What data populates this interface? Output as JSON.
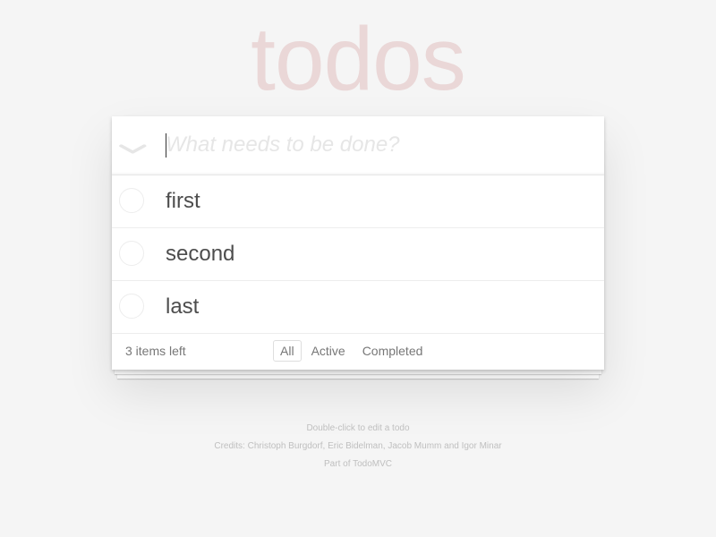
{
  "header": {
    "title": "todos",
    "new_todo_placeholder": "What needs to be done?",
    "toggle_all_glyph": "❯"
  },
  "todos": [
    {
      "label": "first",
      "completed": false
    },
    {
      "label": "second",
      "completed": false
    },
    {
      "label": "last",
      "completed": false
    }
  ],
  "footer": {
    "count_text": "3 items left",
    "filters": [
      {
        "label": "All",
        "selected": true
      },
      {
        "label": "Active",
        "selected": false
      },
      {
        "label": "Completed",
        "selected": false
      }
    ]
  },
  "info": {
    "hint": "Double-click to edit a todo",
    "credits": "Credits: Christoph Burgdorf, Eric Bidelman, Jacob Mumm and Igor Minar",
    "part_of": "Part of TodoMVC"
  },
  "colors": {
    "background": "#f5f5f5",
    "title": "#e9d5d5",
    "text": "#4d4d4d",
    "muted": "#777777",
    "info": "#bfbfbf"
  }
}
